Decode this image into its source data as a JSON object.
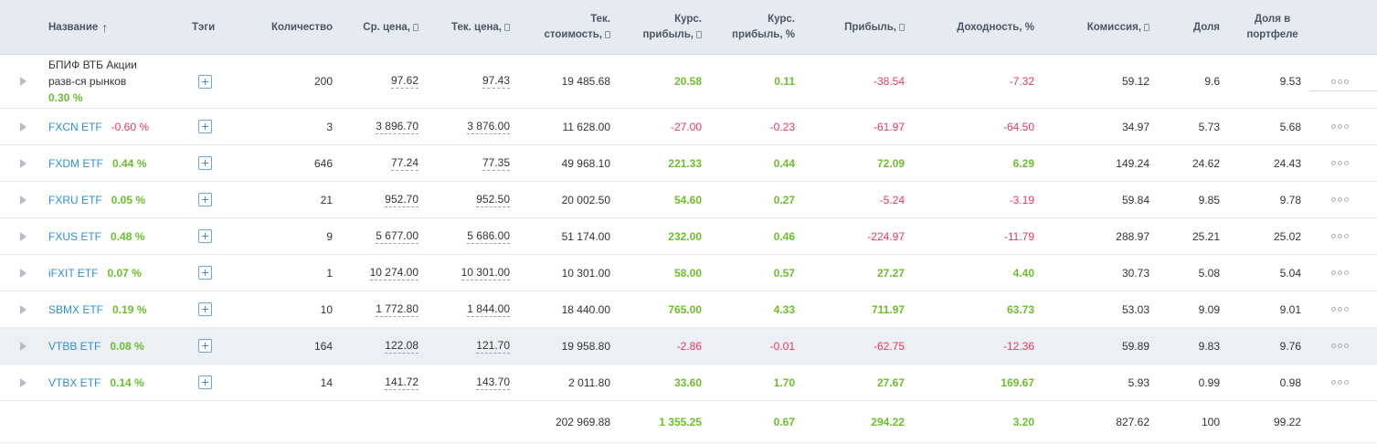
{
  "headers": {
    "name": "Название",
    "tags": "Тэги",
    "qty": "Количество",
    "avg_price": "Ср. цена,",
    "cur_price": "Тек. цена,",
    "cur_value_1": "Тек.",
    "cur_value_2": "стоимость,",
    "fx_profit_1": "Курс.",
    "fx_profit_2": "прибыль,",
    "fx_profit_pct_1": "Курс.",
    "fx_profit_pct_2": "прибыль, %",
    "profit": "Прибыль,",
    "yield": "Доходность, %",
    "commission": "Комиссия,",
    "share": "Доля",
    "share_port_1": "Доля в",
    "share_port_2": "портфеле"
  },
  "rows": [
    {
      "name_line1": "БПИФ ВТБ Акции",
      "name_line2": "разв-ся рынков",
      "change": "0.30 %",
      "change_sign": "pos",
      "qty": "200",
      "avg_price": "97.62",
      "cur_price": "97.43",
      "cur_value": "19 485.68",
      "fx_profit": "20.58",
      "fx_profit_sign": "pos",
      "fx_profit_pct": "0.11",
      "fx_profit_pct_sign": "pos",
      "profit": "-38.54",
      "profit_sign": "neg",
      "yield": "-7.32",
      "yield_sign": "neg",
      "commission": "59.12",
      "share": "9.6",
      "share_port": "9.53"
    },
    {
      "name": "FXCN ETF",
      "change": "-0.60 %",
      "change_sign": "neg",
      "qty": "3",
      "avg_price": "3 896.70",
      "cur_price": "3 876.00",
      "cur_value": "11 628.00",
      "fx_profit": "-27.00",
      "fx_profit_sign": "neg",
      "fx_profit_pct": "-0.23",
      "fx_profit_pct_sign": "neg",
      "profit": "-61.97",
      "profit_sign": "neg",
      "yield": "-64.50",
      "yield_sign": "neg",
      "commission": "34.97",
      "share": "5.73",
      "share_port": "5.68"
    },
    {
      "name": "FXDM ETF",
      "change": "0.44 %",
      "change_sign": "pos",
      "qty": "646",
      "avg_price": "77.24",
      "cur_price": "77.35",
      "cur_value": "49 968.10",
      "fx_profit": "221.33",
      "fx_profit_sign": "pos",
      "fx_profit_pct": "0.44",
      "fx_profit_pct_sign": "pos",
      "profit": "72.09",
      "profit_sign": "pos",
      "yield": "6.29",
      "yield_sign": "pos",
      "commission": "149.24",
      "share": "24.62",
      "share_port": "24.43"
    },
    {
      "name": "FXRU ETF",
      "change": "0.05 %",
      "change_sign": "pos",
      "qty": "21",
      "avg_price": "952.70",
      "cur_price": "952.50",
      "cur_value": "20 002.50",
      "fx_profit": "54.60",
      "fx_profit_sign": "pos",
      "fx_profit_pct": "0.27",
      "fx_profit_pct_sign": "pos",
      "profit": "-5.24",
      "profit_sign": "neg",
      "yield": "-3.19",
      "yield_sign": "neg",
      "commission": "59.84",
      "share": "9.85",
      "share_port": "9.78"
    },
    {
      "name": "FXUS ETF",
      "change": "0.48 %",
      "change_sign": "pos",
      "qty": "9",
      "avg_price": "5 677.00",
      "cur_price": "5 686.00",
      "cur_value": "51 174.00",
      "fx_profit": "232.00",
      "fx_profit_sign": "pos",
      "fx_profit_pct": "0.46",
      "fx_profit_pct_sign": "pos",
      "profit": "-224.97",
      "profit_sign": "neg",
      "yield": "-11.79",
      "yield_sign": "neg",
      "commission": "288.97",
      "share": "25.21",
      "share_port": "25.02"
    },
    {
      "name": "iFXIT ETF",
      "change": "0.07 %",
      "change_sign": "pos",
      "qty": "1",
      "avg_price": "10 274.00",
      "cur_price": "10 301.00",
      "cur_value": "10 301.00",
      "fx_profit": "58.00",
      "fx_profit_sign": "pos",
      "fx_profit_pct": "0.57",
      "fx_profit_pct_sign": "pos",
      "profit": "27.27",
      "profit_sign": "pos",
      "yield": "4.40",
      "yield_sign": "pos",
      "commission": "30.73",
      "share": "5.08",
      "share_port": "5.04"
    },
    {
      "name": "SBMX ETF",
      "change": "0.19 %",
      "change_sign": "pos",
      "qty": "10",
      "avg_price": "1 772.80",
      "cur_price": "1 844.00",
      "cur_value": "18 440.00",
      "fx_profit": "765.00",
      "fx_profit_sign": "pos",
      "fx_profit_pct": "4.33",
      "fx_profit_pct_sign": "pos",
      "profit": "711.97",
      "profit_sign": "pos",
      "yield": "63.73",
      "yield_sign": "pos",
      "commission": "53.03",
      "share": "9.09",
      "share_port": "9.01"
    },
    {
      "name": "VTBB ETF",
      "change": "0.08 %",
      "change_sign": "pos",
      "qty": "164",
      "avg_price": "122.08",
      "cur_price": "121.70",
      "cur_value": "19 958.80",
      "fx_profit": "-2.86",
      "fx_profit_sign": "neg",
      "fx_profit_pct": "-0.01",
      "fx_profit_pct_sign": "neg",
      "profit": "-62.75",
      "profit_sign": "neg",
      "yield": "-12.36",
      "yield_sign": "neg",
      "commission": "59.89",
      "share": "9.83",
      "share_port": "9.76"
    },
    {
      "name": "VTBX ETF",
      "change": "0.14 %",
      "change_sign": "pos",
      "qty": "14",
      "avg_price": "141.72",
      "cur_price": "143.70",
      "cur_value": "2 011.80",
      "fx_profit": "33.60",
      "fx_profit_sign": "pos",
      "fx_profit_pct": "1.70",
      "fx_profit_pct_sign": "pos",
      "profit": "27.67",
      "profit_sign": "pos",
      "yield": "169.67",
      "yield_sign": "pos",
      "commission": "5.93",
      "share": "0.99",
      "share_port": "0.98"
    }
  ],
  "totals": {
    "cur_value": "202 969.88",
    "fx_profit": "1 355.25",
    "fx_profit_pct": "0.67",
    "profit": "294.22",
    "yield": "3.20",
    "commission": "827.62",
    "share": "100",
    "share_port": "99.22"
  },
  "colors": {
    "positive": "#6cbf2c",
    "negative": "#e6385f",
    "link": "#2f8fd0",
    "header_bg": "#e6eaf1"
  },
  "icons": {
    "expand": "triangle-right-icon",
    "tag": "plus-square-icon",
    "more": "more-dots-icon",
    "sort": "arrow-up-icon"
  }
}
